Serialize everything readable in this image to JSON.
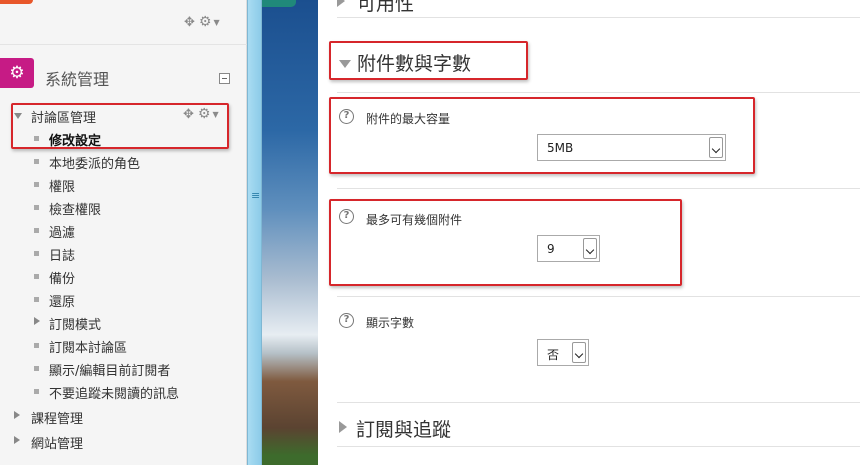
{
  "sidebar": {
    "block_title": "系統管理",
    "icons": {
      "move": "move-icon",
      "gear": "gear-icon",
      "admin": "admin-gears-icon",
      "collapse": "collapse-icon"
    },
    "tree": {
      "forum_admin": "討論區管理",
      "items": [
        "修改設定",
        "本地委派的角色",
        "權限",
        "檢查權限",
        "過濾",
        "日誌",
        "備份",
        "還原"
      ],
      "subscription_mode": "訂閱模式",
      "subscribe_forum": "訂閱本討論區",
      "show_edit_subscribers": "顯示/編輯目前訂閱者",
      "dont_track_unread": "不要追蹤未閱讀的訊息",
      "course_admin": "課程管理",
      "site_admin": "網站管理"
    }
  },
  "main": {
    "top_section_partial": "可用性",
    "attachments_section": {
      "title": "附件數與字數",
      "max_size": {
        "label": "附件的最大容量",
        "value": "5MB"
      },
      "max_attachments": {
        "label": "最多可有幾個附件",
        "value": "9"
      },
      "display_wordcount": {
        "label": "顯示字數",
        "value": "否"
      }
    },
    "subscription_section": {
      "title": "訂閱與追蹤"
    }
  },
  "colors": {
    "highlight_box": "#d6262b",
    "admin_icon_bg": "#c61b85",
    "splitter": "#a9dcf2",
    "top_accent": "#e8572a"
  }
}
